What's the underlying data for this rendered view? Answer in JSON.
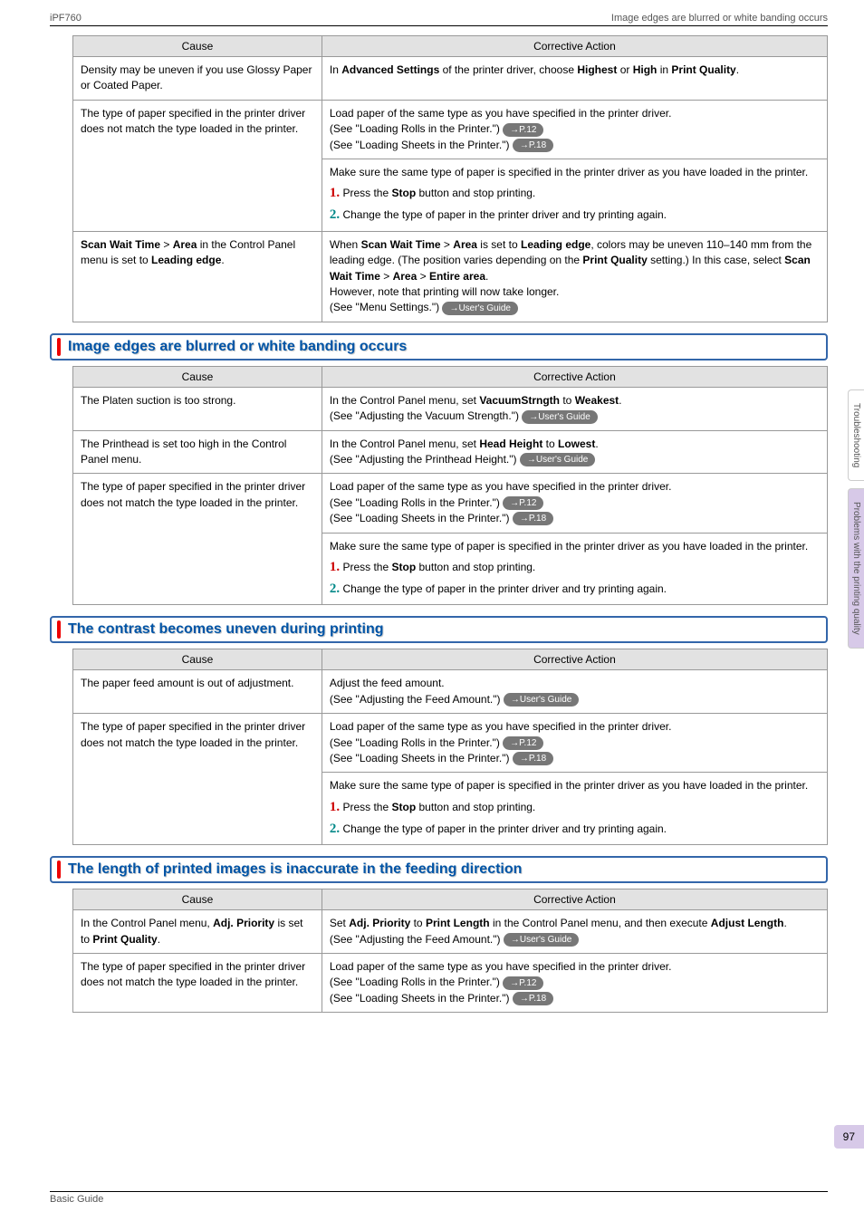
{
  "header": {
    "model": "iPF760",
    "title": "Image edges are blurred or white banding occurs"
  },
  "labels": {
    "cause": "Cause",
    "action": "Corrective Action"
  },
  "pills": {
    "p12": "→P.12",
    "p18": "→P.18",
    "guide": "→User's Guide"
  },
  "steps": {
    "stop": "Press the Stop button and stop printing.",
    "stop_p1": "Press the ",
    "stop_bold": "Stop",
    "stop_p2": " button and stop printing.",
    "change": "Change the type of paper in the printer driver and try printing again."
  },
  "table1": {
    "r1": {
      "cause": "Density may be uneven if you use Glossy Paper or Coated Paper.",
      "a_p1": "In ",
      "a_b1": "Advanced Settings",
      "a_p2": " of the printer driver, choose ",
      "a_b2": "Highest",
      "a_p3": " or ",
      "a_b3": "High",
      "a_p4": " in ",
      "a_b4": "Print Quality",
      "a_p5": "."
    },
    "r2": {
      "cause": "The type of paper specified in the printer driver does not match the type loaded in the printer.",
      "a1_l1": "Load paper of the same type as you have specified in the printer driver.",
      "a1_l2": "(See \"Loading Rolls in the Printer.\") ",
      "a1_l3": "(See \"Loading Sheets in the Printer.\") ",
      "a2_l1": "Make sure the same type of paper is specified in the printer driver as you have loaded in the printer."
    },
    "r3": {
      "cause_b1": "Scan Wait Time",
      "cause_gt1": " > ",
      "cause_b2": "Area",
      "cause_p1": " in the Control Panel menu is set to ",
      "cause_b3": "Leading edge",
      "cause_p2": ".",
      "a_p1": "When ",
      "a_b1": "Scan Wait Time",
      "a_gt1": " > ",
      "a_b2": "Area",
      "a_p2": " is set to ",
      "a_b3": "Leading edge",
      "a_p3": ", colors may be uneven 110–140 mm from the leading edge. (The position varies depending on the ",
      "a_b4": "Print Quality",
      "a_p4": " setting.) In this case, select ",
      "a_b5": "Scan Wait Time",
      "a_gt2": " > ",
      "a_b6": "Area",
      "a_gt3": " > ",
      "a_b7": "Entire area",
      "a_p5": ".",
      "l2": "However, note that printing will now take longer.",
      "l3": "(See \"Menu Settings.\") "
    }
  },
  "section2": {
    "title": "Image edges are blurred or white banding occurs",
    "r1": {
      "cause": "The Platen suction is too strong.",
      "a_p1": "In the Control Panel menu, set ",
      "a_b1": "VacuumStrngth",
      "a_p2": " to ",
      "a_b2": "Weakest",
      "a_p3": ".",
      "l2": "(See \"Adjusting the Vacuum Strength.\") "
    },
    "r2": {
      "cause": "The Printhead is set too high in the Control Panel menu.",
      "a_p1": "In the Control Panel menu, set ",
      "a_b1": "Head Height",
      "a_p2": " to ",
      "a_b2": "Lowest",
      "a_p3": ".",
      "l2": "(See \"Adjusting the Printhead Height.\") "
    },
    "r3": {
      "cause": "The type of paper specified in the printer driver does not match the type loaded in the printer.",
      "same_as": "table1.r2"
    },
    "a2_l1": "Make sure the same type of paper is specified in the printer driver as you have loaded in the printer."
  },
  "section3": {
    "title": "The contrast becomes uneven during printing",
    "r1": {
      "cause": "The paper feed amount is out of adjustment.",
      "l1": "Adjust the feed amount.",
      "l2": "(See \"Adjusting the Feed Amount.\") "
    },
    "r2": {
      "cause": "The type of paper specified in the printer driver does not match the type loaded in the printer."
    },
    "a2_l1": "Make sure the same type of paper is specified in the printer driver as you have loaded in the printer."
  },
  "section4": {
    "title": "The length of printed images is inaccurate in the feeding direction",
    "r1": {
      "cause_p1": "In the Control Panel menu, ",
      "cause_b1": "Adj. Priority",
      "cause_p2": " is set to ",
      "cause_b2": "Print Quality",
      "cause_p3": ".",
      "a_p1": "Set ",
      "a_b1": "Adj. Priority",
      "a_p2": " to ",
      "a_b2": "Print Length",
      "a_p3": " in the Control Panel menu, and then execute ",
      "a_b3": "Adjust Length",
      "a_p4": ".",
      "l2": "(See \"Adjusting the Feed Amount.\") "
    },
    "r2": {
      "cause": "The type of paper specified in the printer driver does not match the type loaded in the printer."
    }
  },
  "side": {
    "tab1": "Troubleshooting",
    "tab2": "Problems with the printing quality"
  },
  "footer": {
    "text": "Basic Guide",
    "page": "97"
  }
}
